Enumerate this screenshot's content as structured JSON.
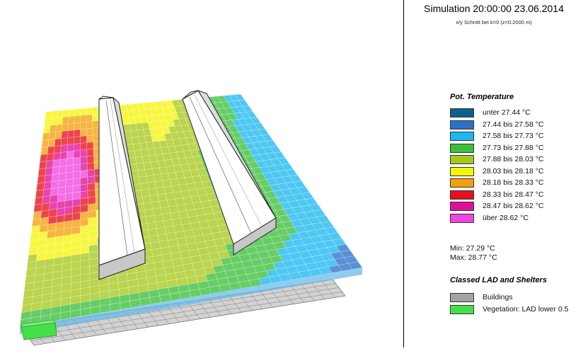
{
  "header": {
    "simulation": "Simulation 20:00:00 23.06.2014",
    "slice": "x/y Schnitt bei k=0 (z=0.2000 m)"
  },
  "temperature_legend": {
    "title": "Pot. Temperature",
    "items": [
      {
        "label": "unter 27.44 °C",
        "color": "#0f5f8f"
      },
      {
        "label": "27.44 bis 27.58 °C",
        "color": "#2a72c8"
      },
      {
        "label": "27.58 bis 27.73 °C",
        "color": "#1cb8ef"
      },
      {
        "label": "27.73 bis 27.88 °C",
        "color": "#3bbf3b"
      },
      {
        "label": "27.88 bis 28.03 °C",
        "color": "#a6c81c"
      },
      {
        "label": "28.03 bis 28.18 °C",
        "color": "#f5f50a"
      },
      {
        "label": "28.18 bis 28.33 °C",
        "color": "#f5a00a"
      },
      {
        "label": "28.33 bis 28.47 °C",
        "color": "#e8101a"
      },
      {
        "label": "28.47 bis 28.62 °C",
        "color": "#e0109a"
      },
      {
        "label": "über 28.62 °C",
        "color": "#f045e0"
      }
    ]
  },
  "stats": {
    "min": "Min: 27.29 °C",
    "max": "Max: 28.77 °C"
  },
  "lad_legend": {
    "title": "Classed LAD and Shelters",
    "items": [
      {
        "label": "Buildings",
        "color": "#a3a3a3"
      },
      {
        "label": "Vegetation: LAD lower 0.5",
        "color": "#45e045"
      }
    ]
  }
}
